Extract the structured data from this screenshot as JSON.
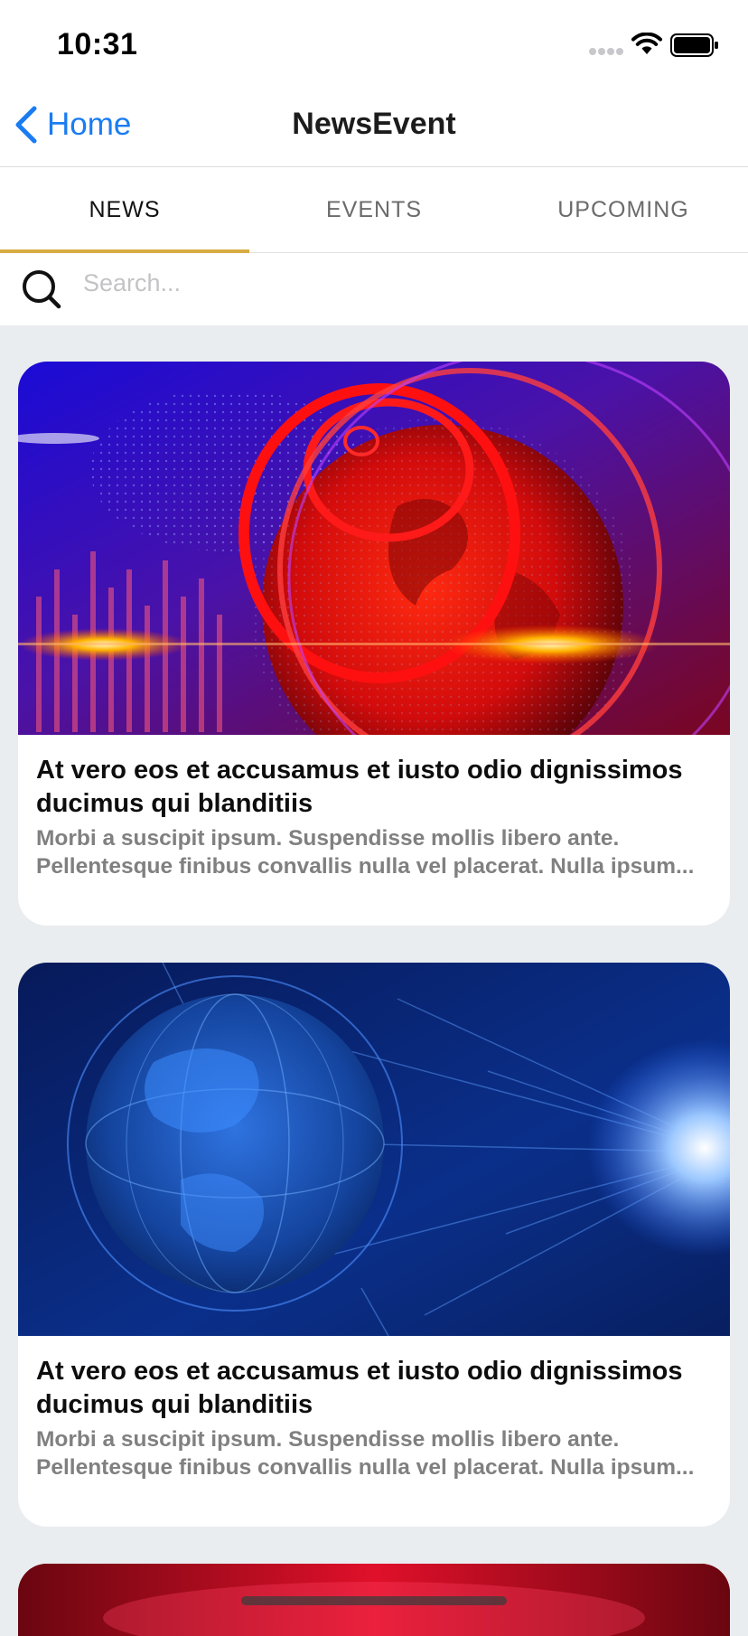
{
  "status_bar": {
    "time": "10:31",
    "icons": [
      "signal-dots-icon",
      "wifi-icon",
      "battery-icon"
    ]
  },
  "nav": {
    "back_label": "Home",
    "title": "NewsEvent",
    "accent_color": "#1a7cf2"
  },
  "tabs": [
    {
      "label": "NEWS",
      "active": true
    },
    {
      "label": "EVENTS",
      "active": false
    },
    {
      "label": "UPCOMING",
      "active": false
    }
  ],
  "tab_indicator_color": "#d7ac43",
  "search": {
    "placeholder": "Search...",
    "value": ""
  },
  "articles": [
    {
      "image_theme": "red-globe-news-background",
      "title": "At vero eos et accusamus et iusto odio dignissimos ducimus qui blanditiis",
      "summary": "Morbi a suscipit ipsum. Suspendisse mollis libero ante. Pellentesque finibus convallis nulla vel placerat. Nulla ipsum..."
    },
    {
      "image_theme": "blue-globe-news-background",
      "title": "At vero eos et accusamus et iusto odio dignissimos ducimus qui blanditiis",
      "summary": "Morbi a suscipit ipsum. Suspendisse mollis libero ante. Pellentesque finibus convallis nulla vel placerat. Nulla ipsum..."
    }
  ]
}
